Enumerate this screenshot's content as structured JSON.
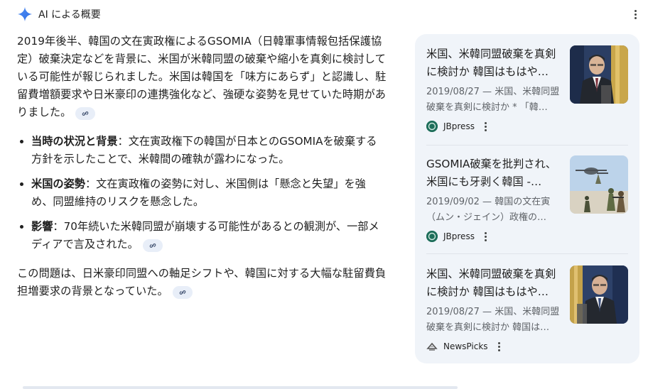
{
  "header": {
    "title": "AI による概要",
    "icon": "sparkle-icon",
    "accent": "#4285f4"
  },
  "main": {
    "intro": "2019年後半、韓国の文在寅政権によるGSOMIA（日韓軍事情報包括保護協定）破棄決定などを背景に、米国が米韓同盟の破棄や縮小を真剣に検討している可能性が報じられました。米国は韓国を「味方にあらず」と認識し、駐留費増額要求や日米豪印の連携強化など、強硬な姿勢を見せていた時期がありました。",
    "bullets": [
      {
        "label": "当時の状況と背景",
        "text": "：文在寅政権下の韓国が日本とのGSOMIAを破棄する方針を示したことで、米韓間の確執が露わになった。"
      },
      {
        "label": "米国の姿勢",
        "text": "：文在寅政権の姿勢に対し、米国側は「懸念と失望」を強め、同盟維持のリスクを懸念した。"
      },
      {
        "label": "影響",
        "text": "：70年続いた米韓同盟が崩壊する可能性があるとの観測が、一部メディアで言及された。"
      }
    ],
    "closing": "この問題は、日米豪印同盟への軸足シフトや、韓国に対する大幅な駐留費負担増要求の背景となっていた。"
  },
  "sources": [
    {
      "title": "米国、米韓同盟破棄を真剣に検討か 韓国はもはや…",
      "snippet": "2019/08/27 — 米国、米韓同盟破棄を真剣に検討か * 「韓…",
      "source": "JBpress",
      "favicon_color": "#1e6e5a"
    },
    {
      "title": "GSOMIA破棄を批判され、米国にも牙剥く韓国 -…",
      "snippet": "2019/09/02 — 韓国の文在寅（ムン・ジェイン）政権の…",
      "source": "JBpress",
      "favicon_color": "#1e6e5a"
    },
    {
      "title": "米国、米韓同盟破棄を真剣に検討か 韓国はもはや…",
      "snippet": "2019/08/27 — 米国、米韓同盟破棄を真剣に検討か 韓国は…",
      "source": "NewsPicks",
      "favicon_color": "#4a4a4a"
    }
  ]
}
